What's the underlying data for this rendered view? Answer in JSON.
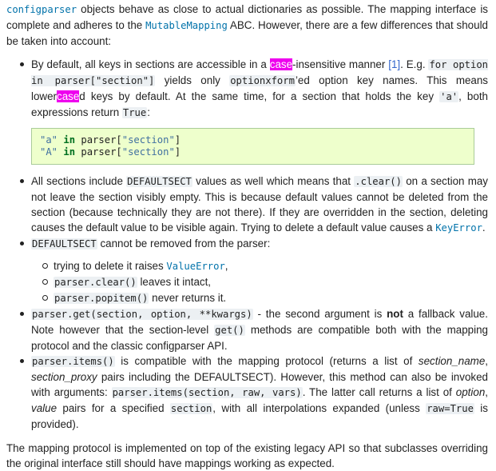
{
  "intro": {
    "mono1": "configparser",
    "t1": " objects behave as close to actual dictionaries as possible. The mapping interface is complete and adheres to the ",
    "link1": "MutableMapping",
    "t2": " ABC. However, there are a few differences that should be taken into account:"
  },
  "bullet1": {
    "t1": "By default, all keys in sections are accessible in a ",
    "hl1": "case",
    "t2": "-insensitive manner ",
    "cite": "[1]",
    "t3": ". E.g. ",
    "c1": "for option in parser[\"section\"]",
    "t4": " yields only ",
    "c2": "optionxform",
    "t5": "’ed option key names. This means lower",
    "hl2": "case",
    "t6": "d keys by default. At the same time, for a section that holds the key ",
    "c3": "'a'",
    "t7": ", both expressions return ",
    "c4": "True",
    "t8": ":"
  },
  "codeblock": {
    "line1_str1": "\"a\"",
    "line1_kw": "in",
    "line1_rest": " parser[",
    "line1_str2": "\"section\"",
    "line1_end": "]",
    "line2_str1": "\"A\"",
    "line2_kw": "in",
    "line2_rest": " parser[",
    "line2_str2": "\"section\"",
    "line2_end": "]"
  },
  "bullet2": {
    "t1": "All sections include ",
    "c1": "DEFAULTSECT",
    "t2": " values as well which means that ",
    "c2": ".clear()",
    "t3": " on a section may not leave the section visibly empty. This is because default values cannot be deleted from the section (because technically they are not there). If they are overridden in the section, deleting causes the default value to be visible again. Trying to delete a default value causes a ",
    "link": "KeyError",
    "t4": "."
  },
  "bullet3": {
    "c1": "DEFAULTSECT",
    "t1": " cannot be removed from the parser:",
    "sub1_t1": "trying to delete it raises ",
    "sub1_link": "ValueError",
    "sub1_t2": ",",
    "sub2_c": "parser.clear()",
    "sub2_t": " leaves it intact,",
    "sub3_c": "parser.popitem()",
    "sub3_t": " never returns it."
  },
  "bullet4": {
    "c1": "parser.get(section, option, **kwargs)",
    "t1": " - the second argument is ",
    "b1": "not",
    "t2": " a fallback value. Note however that the section-level ",
    "c2": "get()",
    "t3": " methods are compatible both with the mapping protocol and the classic configparser API."
  },
  "bullet5": {
    "c1": "parser.items()",
    "t1": " is compatible with the mapping protocol (returns a list of ",
    "i1": "section_name",
    "t2": ", ",
    "i2": "section_proxy",
    "t3": " pairs including the DEFAULTSECT). However, this method can also be invoked with arguments: ",
    "c2": "parser.items(section, raw, vars)",
    "t4": ". The latter call returns a list of ",
    "i3": "option",
    "t5": ", ",
    "i4": "value",
    "t6": " pairs for a specified ",
    "c3": "section",
    "t7": ", with all interpolations expanded (unless ",
    "c4": "raw=True",
    "t8": " is provided)."
  },
  "outro": {
    "t1": "The mapping protocol is implemented on top of the existing legacy API so that subclasses overriding the original interface still should have mappings working as expected."
  },
  "colors": {
    "link": "#0072aa",
    "highlight": "#ee00ee",
    "codeblock_bg": "#eeffcc",
    "inline_code_bg": "#ecf0f3"
  }
}
